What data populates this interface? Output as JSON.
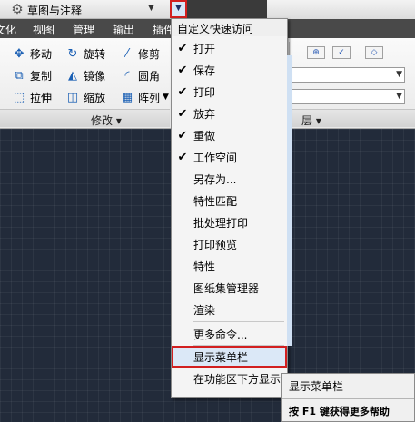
{
  "quick_access": {
    "workspace_label": "草图与注释"
  },
  "ribbon": {
    "tabs": [
      "文化",
      "视图",
      "管理",
      "输出",
      "插件"
    ],
    "tools": [
      {
        "label": "移动",
        "icon": "move-icon"
      },
      {
        "label": "旋转",
        "icon": "rotate-icon"
      },
      {
        "label": "修剪",
        "icon": "trim-icon"
      },
      {
        "label": "复制",
        "icon": "copy-icon"
      },
      {
        "label": "镜像",
        "icon": "mirror-icon"
      },
      {
        "label": "圆角",
        "icon": "fillet-icon"
      },
      {
        "label": "拉伸",
        "icon": "stretch-icon"
      },
      {
        "label": "缩放",
        "icon": "scale-icon"
      },
      {
        "label": "阵列",
        "icon": "array-icon"
      }
    ],
    "modify_panel_label": "修改 ▾",
    "layer_panel_label": "层 ▾"
  },
  "menu": {
    "title": "自定义快速访问",
    "items": [
      {
        "label": "打开",
        "checked": "✔"
      },
      {
        "label": "保存",
        "checked": "✔"
      },
      {
        "label": "打印",
        "checked": "✔"
      },
      {
        "label": "放弃",
        "checked": "✔"
      },
      {
        "label": "重做",
        "checked": "✔"
      },
      {
        "label": "工作空间",
        "checked": "✔"
      },
      {
        "label": "另存为...",
        "checked": ""
      },
      {
        "label": "特性匹配",
        "checked": ""
      },
      {
        "label": "批处理打印",
        "checked": ""
      },
      {
        "label": "打印预览",
        "checked": ""
      },
      {
        "label": "特性",
        "checked": ""
      },
      {
        "label": "图纸集管理器",
        "checked": ""
      },
      {
        "label": "渲染",
        "checked": ""
      }
    ],
    "more_commands": "更多命令...",
    "show_menubar": "显示菜单栏",
    "show_below_ribbon": "在功能区下方显示"
  },
  "tooltip": {
    "title": "显示菜单栏",
    "help": "按 F1 键获得更多帮助"
  },
  "colors": {
    "highlight_border": "#d21f1f",
    "canvas_bg": "#222b3a",
    "tab_bar": "#494949"
  }
}
